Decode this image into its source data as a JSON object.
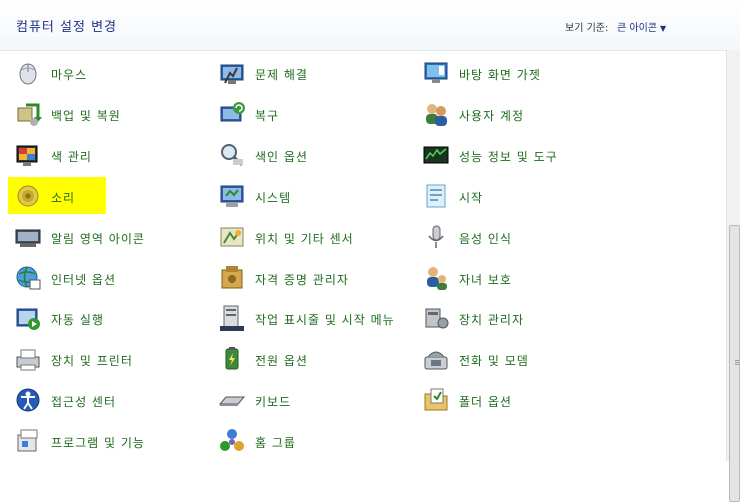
{
  "header": {
    "title": "컴퓨터 설정 변경",
    "view_by_label": "보기 기준:",
    "view_by_value": "큰 아이콘"
  },
  "colors": {
    "label": "#1e6b1e",
    "title": "#1e3287",
    "highlight": "#ffff00"
  },
  "items": [
    {
      "label": "마우스",
      "icon": "mouse-icon"
    },
    {
      "label": "문제 해결",
      "icon": "troubleshooting-icon"
    },
    {
      "label": "바탕 화면 가젯",
      "icon": "desktop-gadgets-icon"
    },
    {
      "label": "백업 및 복원",
      "icon": "backup-restore-icon"
    },
    {
      "label": "복구",
      "icon": "recovery-icon"
    },
    {
      "label": "사용자 계정",
      "icon": "user-accounts-icon"
    },
    {
      "label": "색 관리",
      "icon": "color-management-icon"
    },
    {
      "label": "색인 옵션",
      "icon": "indexing-options-icon"
    },
    {
      "label": "성능 정보 및 도구",
      "icon": "performance-tools-icon"
    },
    {
      "label": "소리",
      "icon": "sound-icon"
    },
    {
      "label": "시스템",
      "icon": "system-icon"
    },
    {
      "label": "시작",
      "icon": "getting-started-icon"
    },
    {
      "label": "알림 영역 아이콘",
      "icon": "notification-area-icon"
    },
    {
      "label": "위치 및 기타 센서",
      "icon": "location-sensors-icon"
    },
    {
      "label": "음성 인식",
      "icon": "speech-recognition-icon"
    },
    {
      "label": "인터넷 옵션",
      "icon": "internet-options-icon"
    },
    {
      "label": "자격 증명 관리자",
      "icon": "credential-manager-icon"
    },
    {
      "label": "자녀 보호",
      "icon": "parental-controls-icon"
    },
    {
      "label": "자동 실행",
      "icon": "autoplay-icon"
    },
    {
      "label": "작업 표시줄 및 시작 메뉴",
      "icon": "taskbar-start-menu-icon"
    },
    {
      "label": "장치 관리자",
      "icon": "device-manager-icon"
    },
    {
      "label": "장치 및 프린터",
      "icon": "devices-printers-icon"
    },
    {
      "label": "전원 옵션",
      "icon": "power-options-icon"
    },
    {
      "label": "전화 및 모뎀",
      "icon": "phone-modem-icon"
    },
    {
      "label": "접근성 센터",
      "icon": "ease-of-access-icon"
    },
    {
      "label": "키보드",
      "icon": "keyboard-icon"
    },
    {
      "label": "폴더 옵션",
      "icon": "folder-options-icon"
    },
    {
      "label": "프로그램 및 기능",
      "icon": "programs-features-icon"
    },
    {
      "label": "홈 그룹",
      "icon": "homegroup-icon"
    }
  ]
}
